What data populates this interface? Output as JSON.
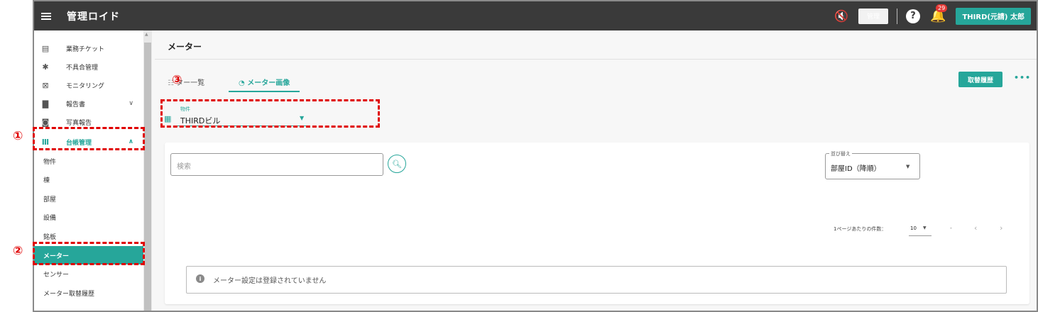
{
  "header": {
    "app_title": "管理ロイド",
    "admin_label": "管理",
    "notification_count": "29",
    "user_label": "THIRD(元請) 太郎",
    "help_glyph": "?"
  },
  "sidebar": {
    "items": [
      {
        "label": "業務チケット",
        "icon": "list-icon"
      },
      {
        "label": "不具合管理",
        "icon": "gear-icon"
      },
      {
        "label": "モニタリング",
        "icon": "monitor-icon"
      },
      {
        "label": "報告書",
        "icon": "document-icon"
      },
      {
        "label": "写真報告",
        "icon": "camera-icon"
      },
      {
        "label": "台帳管理",
        "icon": "books-icon"
      }
    ],
    "sub_items": [
      {
        "label": "物件"
      },
      {
        "label": "棟"
      },
      {
        "label": "部屋"
      },
      {
        "label": "設備"
      },
      {
        "label": "銘板"
      },
      {
        "label": "メーター"
      },
      {
        "label": "センサー"
      },
      {
        "label": "メーター取替履歴"
      }
    ]
  },
  "main": {
    "page_title": "メーター",
    "tabs": [
      {
        "label": "ター一覧"
      },
      {
        "label": "メーター画像"
      }
    ],
    "action_button": "取替履歴",
    "property_field": {
      "label": "物件",
      "value": "THIRDビル"
    },
    "search": {
      "placeholder": "検索"
    },
    "sort": {
      "label": "並び替え",
      "value": "部屋ID（降順）"
    },
    "pagination": {
      "per_page_label": "1ページあたりの件数：",
      "per_page_value": "10",
      "range": "-"
    },
    "empty_message": "メーター設定は登録されていません"
  },
  "annotations": {
    "markers": [
      "①",
      "②",
      "③"
    ],
    "color": "#e00000"
  },
  "colors": {
    "accent": "#26a69a",
    "header_bg": "#3a3a3a"
  }
}
